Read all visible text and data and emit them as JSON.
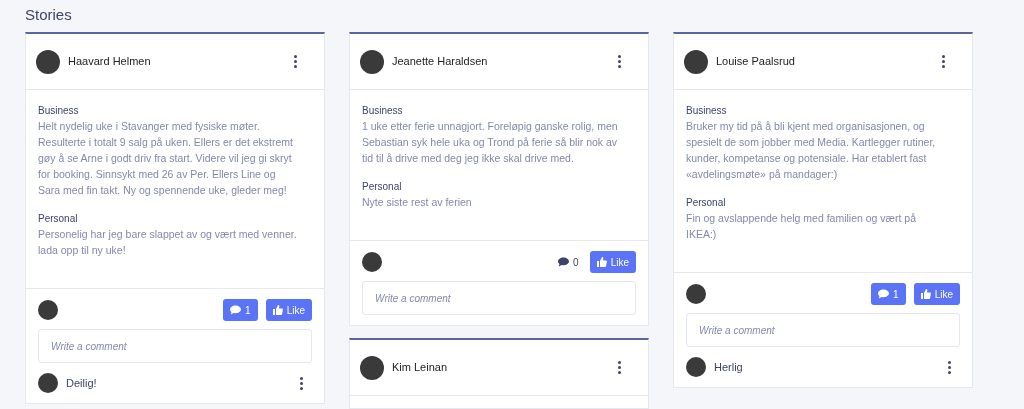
{
  "heading": "Stories",
  "columns": [
    {
      "stories": [
        {
          "author": "Haavard Helmen",
          "sections": [
            {
              "label": "Business",
              "text": "Helt nydelig uke i Stavanger med fysiske møter. Resulterte i totalt 9 salg på uken. Ellers er det ekstremt gøy å se Arne i godt driv fra start. Videre vil jeg gi skryt for booking. Sinnsykt med 26 av Per. Ellers Line og Sara med fin takt. Ny og spennende uke, gleder meg!"
            },
            {
              "label": "Personal",
              "text": "Personelig har jeg bare slappet av og vært med venner. lada opp til ny uke!"
            }
          ],
          "comment_count": "1",
          "has_comments": true,
          "like_label": "Like",
          "comment_placeholder": "Write a comment",
          "comments": [
            {
              "text": "Deilig!"
            }
          ]
        }
      ]
    },
    {
      "stories": [
        {
          "author": "Jeanette Haraldsen",
          "sections": [
            {
              "label": "Business",
              "text": "1 uke etter ferie unnagjort. Foreløpig ganske rolig, men Sebastian syk hele uka og Trond på ferie så blir nok av tid til å drive med deg jeg ikke skal drive med."
            },
            {
              "label": "Personal",
              "text": "Nyte siste rest av ferien"
            }
          ],
          "comment_count": "0",
          "has_comments": false,
          "like_label": "Like",
          "comment_placeholder": "Write a comment"
        },
        {
          "author": "Kim Leinan"
        }
      ]
    },
    {
      "stories": [
        {
          "author": "Louise Paalsrud",
          "sections": [
            {
              "label": "Business",
              "text": "Bruker my tid på å bli kjent med organisasjonen, og spesielt de som jobber med Media. Kartlegger rutiner, kunder, kompetanse og potensiale. Har etablert fast «avdelingsmøte» på mandager:)"
            },
            {
              "label": "Personal",
              "text": "Fin og avslappende helg med familien og vært på IKEA:)"
            }
          ],
          "comment_count": "1",
          "has_comments": true,
          "like_label": "Like",
          "comment_placeholder": "Write a comment",
          "comments": [
            {
              "text": "Herlig"
            }
          ]
        }
      ]
    }
  ]
}
